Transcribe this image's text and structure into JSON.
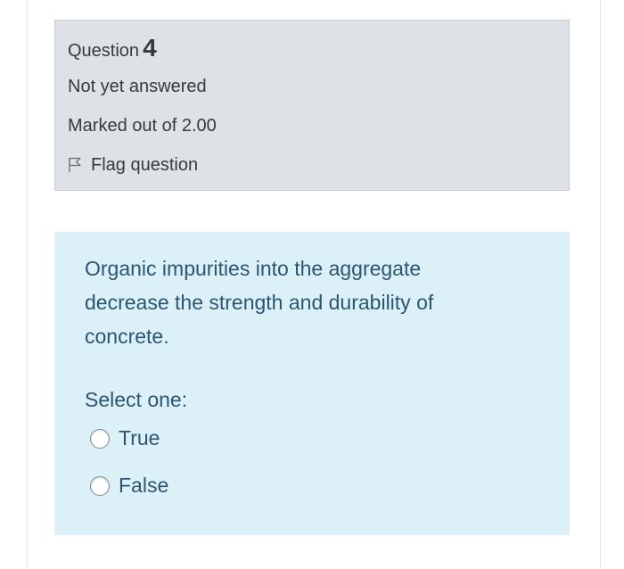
{
  "question": {
    "label": "Question",
    "number": "4",
    "state": "Not yet answered",
    "grade": "Marked out of 2.00",
    "flag_label": "Flag question",
    "flag_icon": "flag-icon"
  },
  "content": {
    "text": "Organic impurities into the aggregate decrease the strength and durability of concrete.",
    "prompt": "Select one:",
    "options": [
      {
        "label": "True",
        "selected": false
      },
      {
        "label": "False",
        "selected": false
      }
    ]
  },
  "colors": {
    "info_background": "#dee2e6",
    "content_background": "#dcf0f7",
    "content_text": "#2b5672"
  }
}
